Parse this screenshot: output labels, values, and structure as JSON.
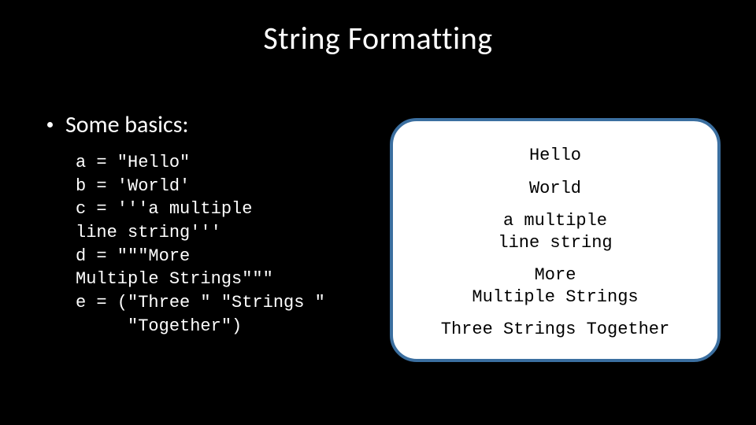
{
  "title": "String Formatting",
  "bullet": "Some basics:",
  "code": {
    "l1": "a = \"Hello\"",
    "l2": "b = 'World'",
    "l3": "c = '''a multiple",
    "l4": "line string'''",
    "l5": "d = \"\"\"More",
    "l6": "Multiple Strings\"\"\"",
    "l7": "e = (\"Three \" \"Strings \"",
    "l8": "     \"Together\")"
  },
  "output": {
    "a": "Hello",
    "b": "World",
    "c1": "a multiple",
    "c2": "line string",
    "d1": "More",
    "d2": "Multiple Strings",
    "e": "Three Strings Together"
  }
}
